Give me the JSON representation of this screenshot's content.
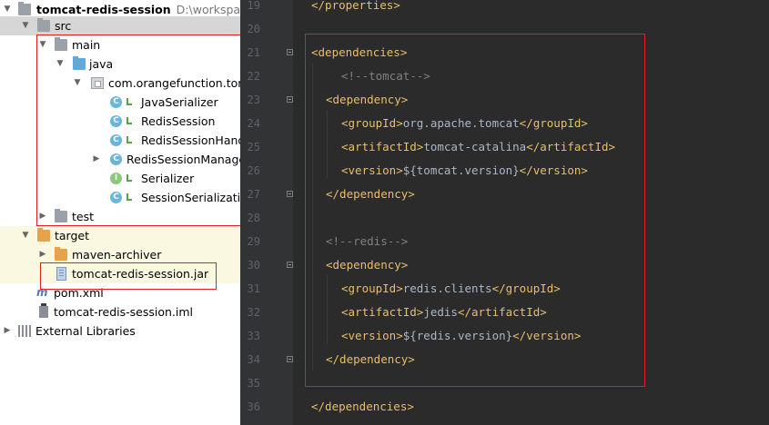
{
  "project_tree": {
    "root": {
      "name": "tomcat-redis-session",
      "path": "D:\\workspace\\l"
    },
    "src": "src",
    "main": "main",
    "java": "java",
    "package": "com.orangefunction.tomc",
    "classes": [
      {
        "name": "JavaSerializer",
        "kind": "class"
      },
      {
        "name": "RedisSession",
        "kind": "class"
      },
      {
        "name": "RedisSessionHand",
        "kind": "class"
      },
      {
        "name": "RedisSessionManage",
        "kind": "class"
      },
      {
        "name": "Serializer",
        "kind": "interface"
      },
      {
        "name": "SessionSerializatio",
        "kind": "class"
      }
    ],
    "test": "test",
    "target": "target",
    "maven_archiver": "maven-archiver",
    "jar": "tomcat-redis-session.jar",
    "pom": "pom.xml",
    "iml": "tomcat-redis-session.iml",
    "external_libraries": "External Libraries",
    "class_badge": "C",
    "interface_badge": "I"
  },
  "editor": {
    "lines": [
      {
        "num": "19",
        "indent": 0,
        "tokens": [
          {
            "t": "</properties>",
            "c": "tag"
          }
        ]
      },
      {
        "num": "20",
        "indent": 0,
        "tokens": []
      },
      {
        "num": "21",
        "indent": 0,
        "tokens": [
          {
            "t": "<dependencies>",
            "c": "tag"
          }
        ]
      },
      {
        "num": "22",
        "indent": 2,
        "tokens": [
          {
            "t": "<!--tomcat-->",
            "c": "cm"
          }
        ]
      },
      {
        "num": "23",
        "indent": 1,
        "tokens": [
          {
            "t": "<dependency>",
            "c": "tag"
          }
        ]
      },
      {
        "num": "24",
        "indent": 2,
        "tokens": [
          {
            "t": "<groupId>",
            "c": "tag"
          },
          {
            "t": "org.apache.tomcat",
            "c": "tx"
          },
          {
            "t": "</groupId>",
            "c": "tag"
          }
        ]
      },
      {
        "num": "25",
        "indent": 2,
        "tokens": [
          {
            "t": "<artifactId>",
            "c": "tag"
          },
          {
            "t": "tomcat-catalina",
            "c": "tx"
          },
          {
            "t": "</artifactId>",
            "c": "tag"
          }
        ]
      },
      {
        "num": "26",
        "indent": 2,
        "tokens": [
          {
            "t": "<version>",
            "c": "tag"
          },
          {
            "t": "${tomcat.version}",
            "c": "tx"
          },
          {
            "t": "</version>",
            "c": "tag"
          }
        ]
      },
      {
        "num": "27",
        "indent": 1,
        "tokens": [
          {
            "t": "</dependency>",
            "c": "tag"
          }
        ]
      },
      {
        "num": "28",
        "indent": 0,
        "tokens": []
      },
      {
        "num": "29",
        "indent": 1,
        "tokens": [
          {
            "t": "<!--redis-->",
            "c": "cm"
          }
        ]
      },
      {
        "num": "30",
        "indent": 1,
        "tokens": [
          {
            "t": "<dependency>",
            "c": "tag"
          }
        ]
      },
      {
        "num": "31",
        "indent": 2,
        "tokens": [
          {
            "t": "<groupId>",
            "c": "tag"
          },
          {
            "t": "redis.clients",
            "c": "tx"
          },
          {
            "t": "</groupId>",
            "c": "tag"
          }
        ]
      },
      {
        "num": "32",
        "indent": 2,
        "tokens": [
          {
            "t": "<artifactId>",
            "c": "tag"
          },
          {
            "t": "jedis",
            "c": "tx"
          },
          {
            "t": "</artifactId>",
            "c": "tag"
          }
        ]
      },
      {
        "num": "33",
        "indent": 2,
        "tokens": [
          {
            "t": "<version>",
            "c": "tag"
          },
          {
            "t": "${redis.version}",
            "c": "tx"
          },
          {
            "t": "</version>",
            "c": "tag"
          }
        ]
      },
      {
        "num": "34",
        "indent": 1,
        "tokens": [
          {
            "t": "</dependency>",
            "c": "tag"
          }
        ]
      },
      {
        "num": "35",
        "indent": 0,
        "tokens": []
      },
      {
        "num": "36",
        "indent": 0,
        "tokens": [
          {
            "t": "</dependencies>",
            "c": "tag"
          }
        ]
      }
    ]
  },
  "colors": {
    "editor_bg": "#2b2b2b",
    "gutter_bg": "#313335",
    "xml_tag": "#e8bf6a",
    "xml_comment": "#808080",
    "xml_text": "#a9b7c6",
    "annotation_red": "#e02020",
    "tree_selection": "#d6d6d6",
    "tree_highlight": "#fbf8e1"
  }
}
